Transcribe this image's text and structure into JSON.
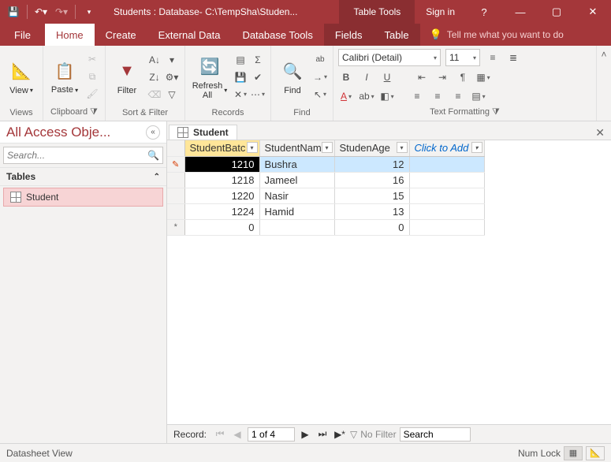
{
  "titlebar": {
    "app_title": "Students : Database- C:\\TempSha\\Studen...",
    "context_tab": "Table Tools",
    "sign_in": "Sign in"
  },
  "ribbon_tabs": {
    "file": "File",
    "home": "Home",
    "create": "Create",
    "external_data": "External Data",
    "database_tools": "Database Tools",
    "fields": "Fields",
    "table": "Table",
    "tell_me": "Tell me what you want to do"
  },
  "ribbon": {
    "views_label": "Views",
    "view_btn": "View",
    "clipboard_label": "Clipboard",
    "paste_btn": "Paste",
    "sort_filter_label": "Sort & Filter",
    "filter_btn": "Filter",
    "records_label": "Records",
    "refresh_btn": "Refresh\nAll",
    "find_label": "Find",
    "find_btn": "Find",
    "text_formatting_label": "Text Formatting",
    "font_name": "Calibri (Detail)",
    "font_size": "11"
  },
  "nav": {
    "header": "All Access Obje...",
    "search_placeholder": "Search...",
    "section": "Tables",
    "item": "Student"
  },
  "doc": {
    "tab_label": "Student",
    "columns": {
      "c1": "StudentBatc",
      "c2": "StudentNam",
      "c3": "StudenAge",
      "add": "Click to Add"
    },
    "rows": [
      {
        "batch": "1210",
        "name": "Bushra",
        "age": "12",
        "selected": true
      },
      {
        "batch": "1218",
        "name": "Jameel",
        "age": "16"
      },
      {
        "batch": "1220",
        "name": "Nasir",
        "age": "15"
      },
      {
        "batch": "1224",
        "name": "Hamid",
        "age": "13"
      }
    ],
    "newrow": {
      "batch": "0",
      "age": "0"
    }
  },
  "recnav": {
    "label": "Record:",
    "pos": "1 of 4",
    "no_filter": "No Filter",
    "search": "Search"
  },
  "status": {
    "view": "Datasheet View",
    "numlock": "Num Lock"
  }
}
